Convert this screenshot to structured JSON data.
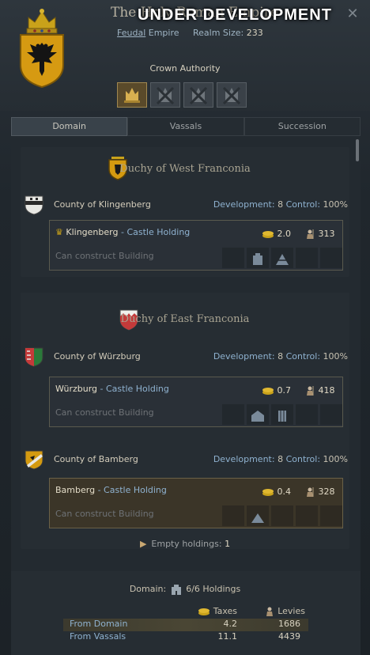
{
  "header": {
    "title": "The Holy Roman Empire",
    "banner": "UNDER DEVELOPMENT",
    "government": "Feudal",
    "rank": "Empire",
    "realm_size_label": "Realm Size:",
    "realm_size": "233",
    "crown_authority_label": "Crown Authority",
    "crown_authority_level": 1,
    "crown_authority_max": 4
  },
  "tabs": [
    "Domain",
    "Vassals",
    "Succession"
  ],
  "active_tab": "Domain",
  "duchies": [
    {
      "name": "Duchy of West Franconia",
      "counties": [
        {
          "name": "County of Klingenberg",
          "development_label": "Development:",
          "development": "8",
          "control_label": "Control:",
          "control": "100%",
          "holding": {
            "name": "Klingenberg",
            "type": "Castle Holding",
            "capital": true,
            "taxes": "2.0",
            "levies": "313",
            "construct_text": "Can construct Building"
          }
        }
      ]
    },
    {
      "name": "Duchy of East Franconia",
      "counties": [
        {
          "name": "County of Würzburg",
          "development_label": "Development:",
          "development": "8",
          "control_label": "Control:",
          "control": "100%",
          "holding": {
            "name": "Würzburg",
            "type": "Castle Holding",
            "capital": false,
            "taxes": "0.7",
            "levies": "418",
            "construct_text": "Can construct Building"
          }
        },
        {
          "name": "County of Bamberg",
          "development_label": "Development:",
          "development": "8",
          "control_label": "Control:",
          "control": "100%",
          "holding": {
            "name": "Bamberg",
            "type": "Castle Holding",
            "capital": false,
            "taxes": "0.4",
            "levies": "328",
            "construct_text": "Can construct Building"
          }
        }
      ]
    }
  ],
  "empty_holdings_label": "Empty holdings:",
  "empty_holdings": "1",
  "summary": {
    "domain_label": "Domain:",
    "holdings": "6/6 Holdings",
    "taxes_header": "Taxes",
    "levies_header": "Levies",
    "rows": [
      {
        "label": "From Domain",
        "taxes": "4.2",
        "levies": "1686"
      },
      {
        "label": "From Vassals",
        "taxes": "11.1",
        "levies": "4439"
      }
    ]
  },
  "colors": {
    "link_blue": "#8fb2d0",
    "gold": "#c9a21a",
    "panel_bg": "#232a30"
  }
}
